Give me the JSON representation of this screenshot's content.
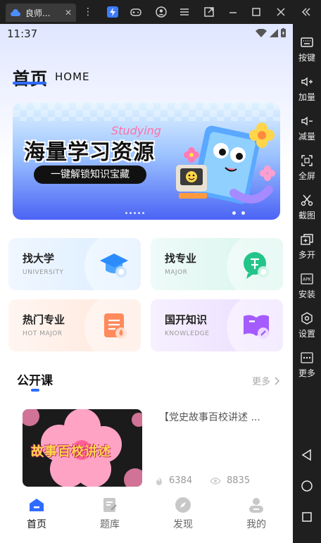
{
  "emulator": {
    "tab_title": "良师...",
    "tab_close": "✕",
    "sidebar": [
      {
        "label": "按键",
        "icon": "keyboard-icon"
      },
      {
        "label": "加量",
        "icon": "volume-up-icon"
      },
      {
        "label": "减量",
        "icon": "volume-down-icon"
      },
      {
        "label": "全屏",
        "icon": "fullscreen-icon"
      },
      {
        "label": "截图",
        "icon": "scissors-icon"
      },
      {
        "label": "多开",
        "icon": "multi-instance-icon"
      },
      {
        "label": "安装",
        "icon": "apk-install-icon"
      },
      {
        "label": "设置",
        "icon": "settings-icon"
      },
      {
        "label": "更多",
        "icon": "more-icon"
      }
    ]
  },
  "status_bar": {
    "time": "11:37"
  },
  "header": {
    "title": "首页",
    "subtitle": "HOME"
  },
  "banner": {
    "headline": "海量学习资源",
    "pill": "一键解锁知识宝藏",
    "script": "Studying"
  },
  "categories": [
    {
      "title": "找大学",
      "subtitle": "UNIVERSITY",
      "icon": "graduation-cap-icon",
      "bg": "#e6f2ff"
    },
    {
      "title": "找专业",
      "subtitle": "MAJOR",
      "icon": "major-chat-icon",
      "bg": "#e4f8f3"
    },
    {
      "title": "热门专业",
      "subtitle": "HOT MAJOR",
      "icon": "hot-major-doc-icon",
      "bg": "#fff1ea"
    },
    {
      "title": "国开知识",
      "subtitle": "KNOWLEDGE",
      "icon": "knowledge-book-icon",
      "bg": "#f1eaff"
    }
  ],
  "section": {
    "title": "公开课",
    "more": "更多"
  },
  "course": {
    "thumb_text": "故事百校讲述",
    "title": "【党史故事百校讲述 ...",
    "hot_count": "6384",
    "view_count": "8835"
  },
  "tabbar": [
    {
      "label": "首页",
      "icon": "home-icon",
      "active": true
    },
    {
      "label": "题库",
      "icon": "question-bank-icon",
      "active": false
    },
    {
      "label": "发现",
      "icon": "discover-compass-icon",
      "active": false
    },
    {
      "label": "我的",
      "icon": "profile-icon",
      "active": false
    }
  ],
  "colors": {
    "accent": "#2f6bff"
  }
}
